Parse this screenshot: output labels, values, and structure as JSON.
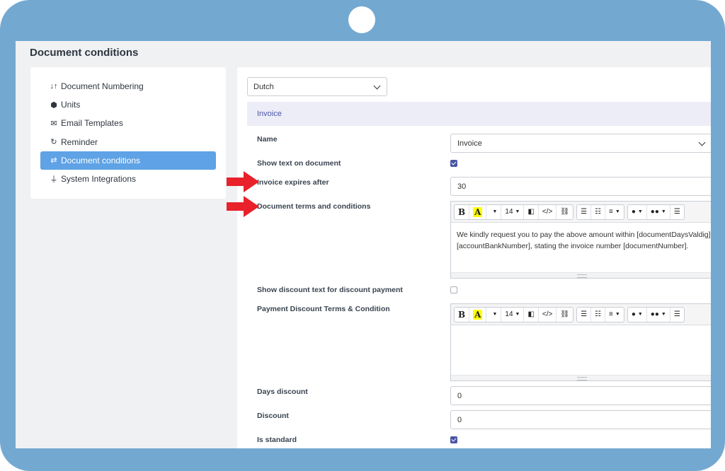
{
  "page": {
    "title": "Document conditions"
  },
  "sidebar": {
    "items": [
      {
        "label": "Document Numbering",
        "icon": "sort-icon",
        "glyph": "↓↑"
      },
      {
        "label": "Units",
        "icon": "cube-icon",
        "glyph": "⬢"
      },
      {
        "label": "Email Templates",
        "icon": "envelope-icon",
        "glyph": "✉"
      },
      {
        "label": "Reminder",
        "icon": "refresh-icon",
        "glyph": "↻"
      },
      {
        "label": "Document conditions",
        "icon": "exchange-icon",
        "glyph": "⇄",
        "active": true
      },
      {
        "label": "System Integrations",
        "icon": "plug-icon",
        "glyph": "⏚"
      }
    ]
  },
  "main": {
    "language": {
      "value": "Dutch"
    },
    "section": {
      "title": "Invoice"
    },
    "form": {
      "name": {
        "label": "Name",
        "value": "Invoice"
      },
      "show_text": {
        "label": "Show text on document",
        "checked": true
      },
      "expires": {
        "label": "Invoice expires after",
        "value": "30"
      },
      "terms": {
        "label": "Document terms and conditions",
        "line1": "We kindly request you to pay the above amount within [documentDaysValdig] days",
        "line2": "[accountBankNumber], stating the invoice number [documentNumber]."
      },
      "show_discount": {
        "label": "Show discount text for discount payment",
        "checked": false
      },
      "payment_discount": {
        "label": "Payment Discount Terms & Condition",
        "text": ""
      },
      "days_discount": {
        "label": "Days discount",
        "value": "0"
      },
      "discount": {
        "label": "Discount",
        "value": "0"
      },
      "is_standard": {
        "label": "Is standard",
        "checked": true
      }
    },
    "toolbar": {
      "bold": "B",
      "highlight": "A",
      "font_size": "14",
      "code": "</>"
    }
  },
  "colors": {
    "frame": "#73a9d1",
    "accent": "#5fa2e5",
    "checkbox": "#4b55a6",
    "arrow": "#e8212b"
  }
}
